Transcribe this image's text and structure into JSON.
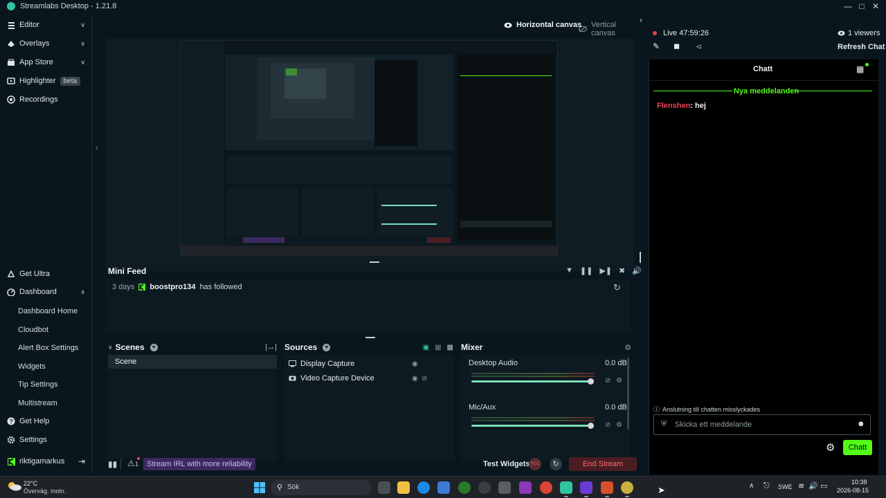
{
  "window": {
    "title": "Streamlabs Desktop - 1.21.8"
  },
  "nav": {
    "top_items": [
      {
        "label": "Editor",
        "icon": "editor-icon"
      },
      {
        "label": "Overlays",
        "icon": "overlays-icon"
      },
      {
        "label": "App Store",
        "icon": "app-store-icon"
      },
      {
        "label": "Highlighter",
        "icon": "highlighter-icon",
        "badge": "beta"
      },
      {
        "label": "Recordings",
        "icon": "recordings-icon"
      }
    ],
    "bottom_items": {
      "get_ultra": "Get Ultra",
      "dashboard": "Dashboard",
      "dashboard_sub": [
        "Dashboard Home",
        "Cloudbot",
        "Alert Box Settings",
        "Widgets",
        "Tip Settings",
        "Multistream"
      ],
      "get_help": "Get Help",
      "settings": "Settings",
      "user": "riktigamarkus"
    }
  },
  "canvas": {
    "horizontal": "Horizontal canvas",
    "vertical": "Vertical canvas"
  },
  "minifeed": {
    "title": "Mini Feed",
    "events": [
      {
        "time": "3 days",
        "user": "boostpro134",
        "action": "has followed"
      }
    ]
  },
  "scenes": {
    "title": "Scenes",
    "items": [
      "Scene"
    ]
  },
  "sources": {
    "title": "Sources",
    "items": [
      "Display Capture",
      "Video Capture Device"
    ]
  },
  "mixer": {
    "title": "Mixer",
    "channels": [
      {
        "name": "Desktop Audio",
        "level": "0.0 dB",
        "volume": 1.0
      },
      {
        "name": "Mic/Aux",
        "level": "0.0 dB",
        "volume": 1.0
      }
    ]
  },
  "bottombar": {
    "irl_promo": "Stream IRL with more reliability",
    "alert_count": "1",
    "test_widgets": "Test Widgets",
    "rec_label": "REC",
    "end_stream": "End Stream"
  },
  "chat": {
    "live_label": "Live 47:59:26",
    "viewers": "1 viewers",
    "refresh": "Refresh Chat",
    "header": "Chatt",
    "new_messages": "Nya meddelanden",
    "messages": [
      {
        "user": "Flenshen",
        "text": ": hej"
      }
    ],
    "connection_error": "Anslutning till chatten misslyckades",
    "input_placeholder": "Skicka ett meddelande",
    "send_label": "Chatt"
  },
  "taskbar": {
    "weather_temp": "22°C",
    "weather_desc": "Överväg. moln.",
    "search_placeholder": "Sök",
    "lang": "SWE",
    "time": "10:38",
    "date": "2026-08-15"
  },
  "colors": {
    "accent": "#31c3a2",
    "chat_green": "#53fc18",
    "live_red": "#e04545",
    "purple": "#3c2a5e",
    "end_stream_bg": "#4a1d22",
    "end_stream_fg": "#ff6b6b"
  }
}
